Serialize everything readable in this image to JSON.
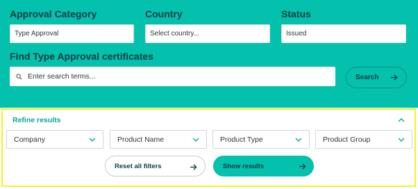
{
  "filters": {
    "approval_category": {
      "label": "Approval Category",
      "value": "Type Approval"
    },
    "country": {
      "label": "Country",
      "placeholder": "Select country..."
    },
    "status": {
      "label": "Status",
      "value": "Issued"
    }
  },
  "search": {
    "heading": "Find Type Approval certificates",
    "placeholder": "Enter search terms...",
    "button_label": "Search"
  },
  "refine": {
    "title": "Refine results",
    "dropdowns": [
      "Company",
      "Product Name",
      "Product Type",
      "Product Group"
    ],
    "reset_label": "Reset all filters",
    "show_label": "Show results"
  },
  "colors": {
    "accent": "#04c1ad",
    "text_dark": "#143a45",
    "highlight": "#f1f51a"
  },
  "icons": [
    "search-icon",
    "arrow-right-icon",
    "chevron-up-icon",
    "chevron-down-icon"
  ]
}
